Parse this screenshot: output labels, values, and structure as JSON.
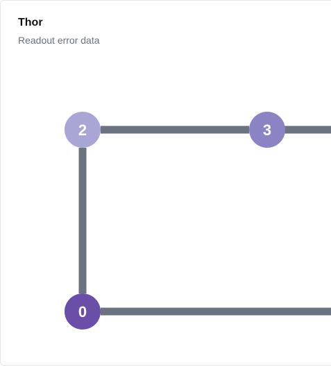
{
  "card": {
    "title": "Thor",
    "subtitle": "Readout error data"
  },
  "colors": {
    "edge": "#6b7280",
    "node_light": "#a8a6d5",
    "node_medium": "#8b84c4",
    "node_dark": "#6b4ea8"
  },
  "qubit_map": {
    "nodes": [
      {
        "id": "2",
        "label": "2",
        "color": "#a8a6d5"
      },
      {
        "id": "3",
        "label": "3",
        "color": "#8b84c4"
      },
      {
        "id": "0",
        "label": "0",
        "color": "#6b4ea8"
      }
    ],
    "edges": [
      {
        "from": "2",
        "to": "3"
      },
      {
        "from": "2",
        "to": "0"
      },
      {
        "from": "3",
        "to": "right-offscreen"
      },
      {
        "from": "0",
        "to": "right-offscreen"
      }
    ]
  }
}
